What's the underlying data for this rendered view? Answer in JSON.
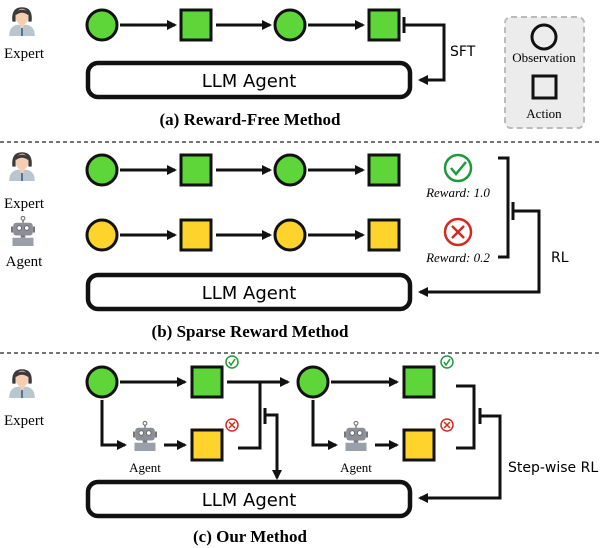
{
  "colors": {
    "expert_fill": "#5ed63a",
    "agent_fill": "#fdd32c",
    "stroke": "#111111",
    "check": "#1e9a3c",
    "cross": "#d42a1e",
    "legend_bg": "#ececec",
    "legend_border": "#bbbbbb"
  },
  "actors": {
    "expert": "Expert",
    "agent": "Agent"
  },
  "llm_agent_label": "LLM Agent",
  "legend": {
    "observation": "Observation",
    "action": "Action"
  },
  "panel_a": {
    "caption": "(a) Reward-Free Method",
    "feedback_label": "SFT",
    "trajectory": [
      "observation",
      "action",
      "observation",
      "action"
    ]
  },
  "panel_b": {
    "caption": "(b) Sparse Reward Method",
    "feedback_label": "RL",
    "expert_reward": "Reward: 1.0",
    "agent_reward": "Reward: 0.2"
  },
  "panel_c": {
    "caption": "(c) Our Method",
    "feedback_label": "Step-wise RL"
  }
}
